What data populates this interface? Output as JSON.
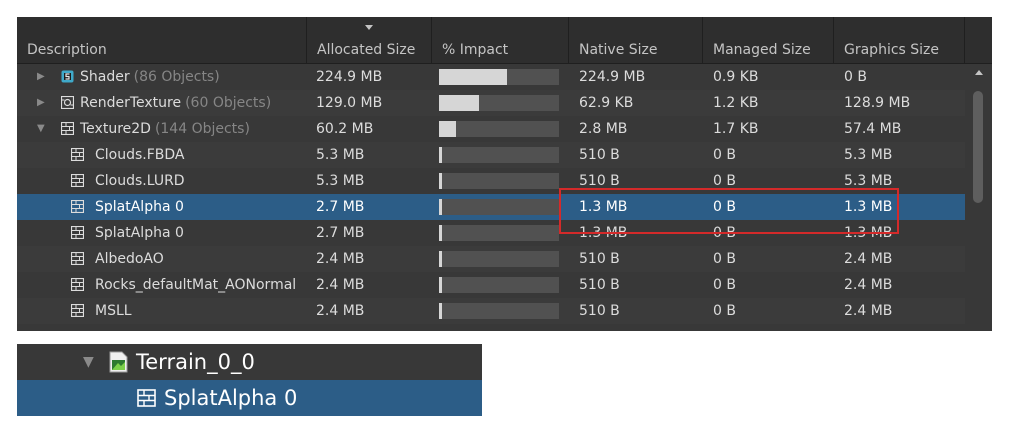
{
  "table": {
    "columns": [
      {
        "label": "Description"
      },
      {
        "label": "Allocated Size"
      },
      {
        "label": "% Impact"
      },
      {
        "label": "Native Size"
      },
      {
        "label": "Managed Size"
      },
      {
        "label": "Graphics Size"
      }
    ],
    "sorted_column": "Allocated Size",
    "rows": [
      {
        "name": "Shader",
        "count": "(86 Objects)",
        "icon": "shader-icon",
        "expandable": true,
        "expanded": false,
        "allocated": "224.9 MB",
        "impact": 0.48,
        "native": "224.9 MB",
        "managed": "0.9 KB",
        "graphics": "0 B"
      },
      {
        "name": "RenderTexture",
        "count": "(60 Objects)",
        "icon": "render-texture-icon",
        "expandable": true,
        "expanded": false,
        "allocated": "129.0 MB",
        "impact": 0.28,
        "native": "62.9 KB",
        "managed": "1.2 KB",
        "graphics": "128.9 MB"
      },
      {
        "name": "Texture2D",
        "count": "(144 Objects)",
        "icon": "texture2d-icon",
        "expandable": true,
        "expanded": true,
        "allocated": "60.2 MB",
        "impact": 0.12,
        "native": "2.8 MB",
        "managed": "1.7 KB",
        "graphics": "57.4 MB"
      },
      {
        "name": "Clouds.FBDA",
        "count": "",
        "icon": "texture2d-icon",
        "expandable": false,
        "allocated": "5.3 MB",
        "impact": 0.015,
        "native": "510 B",
        "managed": "0 B",
        "graphics": "5.3 MB"
      },
      {
        "name": "Clouds.LURD",
        "count": "",
        "icon": "texture2d-icon",
        "expandable": false,
        "allocated": "5.3 MB",
        "impact": 0.015,
        "native": "510 B",
        "managed": "0 B",
        "graphics": "5.3 MB"
      },
      {
        "name": "SplatAlpha 0",
        "count": "",
        "icon": "texture2d-icon",
        "expandable": false,
        "selected": true,
        "allocated": "2.7 MB",
        "impact": 0.012,
        "native": "1.3 MB",
        "managed": "0 B",
        "graphics": "1.3 MB"
      },
      {
        "name": "SplatAlpha 0",
        "count": "",
        "icon": "texture2d-icon",
        "expandable": false,
        "allocated": "2.7 MB",
        "impact": 0.012,
        "native": "1.3 MB",
        "managed": "0 B",
        "graphics": "1.3 MB"
      },
      {
        "name": "AlbedoAO",
        "count": "",
        "icon": "texture2d-icon",
        "expandable": false,
        "allocated": "2.4 MB",
        "impact": 0.012,
        "native": "510 B",
        "managed": "0 B",
        "graphics": "2.4 MB"
      },
      {
        "name": "Rocks_defaultMat_AONormal",
        "count": "",
        "icon": "texture2d-icon",
        "expandable": false,
        "allocated": "2.4 MB",
        "impact": 0.012,
        "native": "510 B",
        "managed": "0 B",
        "graphics": "2.4 MB"
      },
      {
        "name": "MSLL",
        "count": "",
        "icon": "texture2d-icon",
        "expandable": false,
        "allocated": "2.4 MB",
        "impact": 0.012,
        "native": "510 B",
        "managed": "0 B",
        "graphics": "2.4 MB"
      }
    ]
  },
  "highlight": {
    "color": "#d42a2a"
  },
  "references": {
    "parent": {
      "name": "Terrain_0_0",
      "icon": "terrain-icon",
      "expanded": true
    },
    "child": {
      "name": "SplatAlpha 0",
      "icon": "texture2d-icon",
      "selected": true
    }
  },
  "colors": {
    "panel_bg": "#383838",
    "header_bg": "#2e2e2e",
    "selection": "#2c5d87",
    "bar_fill": "#d6d6d6",
    "bar_track": "#515151"
  }
}
